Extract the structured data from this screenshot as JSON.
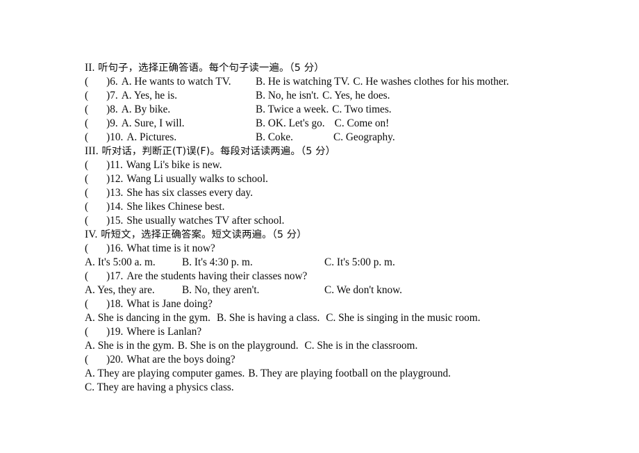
{
  "document": {
    "type": "listening-test-paper",
    "language": "zh-CN + en"
  },
  "sections": [
    {
      "id": "section-2",
      "heading": "II. 听句子，选择正确答语。每个句子读一遍。（5 分）",
      "roman": "II.",
      "chinese": " 听句子，选择正确答语。每个句子读一遍。（5 分）",
      "questions": [
        {
          "paren": "(",
          "close": ")",
          "number": "6.",
          "optA": "A. He wants to watch TV.",
          "optB": "B. He is watching TV.",
          "optC": "C. He washes clothes for his mother.",
          "layout": "B-tab-C-inline"
        },
        {
          "paren": "(",
          "close": ")",
          "number": "7.",
          "optA": "A. Yes, he is.",
          "optB": "B. No, he isn't.",
          "optC": "C. Yes, he does.",
          "layout": "B-tab-C-inline"
        },
        {
          "paren": "(",
          "close": ")",
          "number": "8.",
          "optA": "A. By bike.",
          "optB": "B. Twice a week.",
          "optC": "C. Two times.",
          "layout": "B-tab-C-inline"
        },
        {
          "paren": "(",
          "close": ")",
          "number": "9.",
          "optA": "A. Sure, I will.",
          "optB": "B. OK. Let's go.",
          "optC": "C. Come on!",
          "layout": "B-tab-C-inline"
        },
        {
          "paren": "(",
          "close": ")",
          "number": "10.",
          "optA": "A. Pictures.",
          "optB": "B. Coke.",
          "optC": "C. Geography.",
          "layout": "B-tab-C-tab"
        }
      ]
    },
    {
      "id": "section-3",
      "heading": "III. 听对话，判断正(T)误(F)。每段对话读两遍。（5 分）",
      "roman": "III.",
      "chinese": " 听对话，判断正(T)误(F)。每段对话读两遍。（5 分）",
      "statements": [
        {
          "paren": "(",
          "close": ")",
          "number": "11.",
          "text": "Wang Li's bike is new."
        },
        {
          "paren": "(",
          "close": ")",
          "number": "12.",
          "text": "Wang Li usually walks to school."
        },
        {
          "paren": "(",
          "close": ")",
          "number": "13.",
          "text": "She has six classes every day."
        },
        {
          "paren": "(",
          "close": ")",
          "number": "14.",
          "text": "She likes Chinese best."
        },
        {
          "paren": "(",
          "close": ")",
          "number": "15.",
          "text": "She usually watches TV after school."
        }
      ]
    },
    {
      "id": "section-4",
      "heading": "IV. 听短文，选择正确答案。短文读两遍。（5 分）",
      "roman": "IV.",
      "chinese": " 听短文，选择正确答案。短文读两遍。（5 分）",
      "questions": [
        {
          "paren": "(",
          "close": ")",
          "number": "16.",
          "question": "What time is it now?",
          "optA": "A. It's 5:00 a. m.",
          "optB": "B. It's 4:30 p. m.",
          "optC": "C. It's 5:00 p. m.",
          "layout": "columns"
        },
        {
          "paren": "(",
          "close": ")",
          "number": "17.",
          "question": "Are the students having their classes now?",
          "optA": "A. Yes, they are.",
          "optB": "B. No, they aren't.",
          "optC": "C. We don't know.",
          "layout": "columns"
        },
        {
          "paren": "(",
          "close": ")",
          "number": "18.",
          "question": "What is Jane doing?",
          "optA": "A. She is dancing in the gym.",
          "optB": "B. She is having a class.",
          "optC": "C. She is singing in the music room.",
          "layout": "inline"
        },
        {
          "paren": "(",
          "close": ")",
          "number": "19.",
          "question": "Where is Lanlan?",
          "optA": "A. She is in the gym.",
          "optB": "B. She is on the playground.",
          "optC": "C. She is in the classroom.",
          "layout": "inline"
        },
        {
          "paren": "(",
          "close": ")",
          "number": "20.",
          "question": "What are the boys doing?",
          "optA": "A. They are playing computer games.",
          "optB": "B. They are playing football on the playground.",
          "optC": "C. They are having a physics class.",
          "layout": "wrap"
        }
      ]
    }
  ]
}
